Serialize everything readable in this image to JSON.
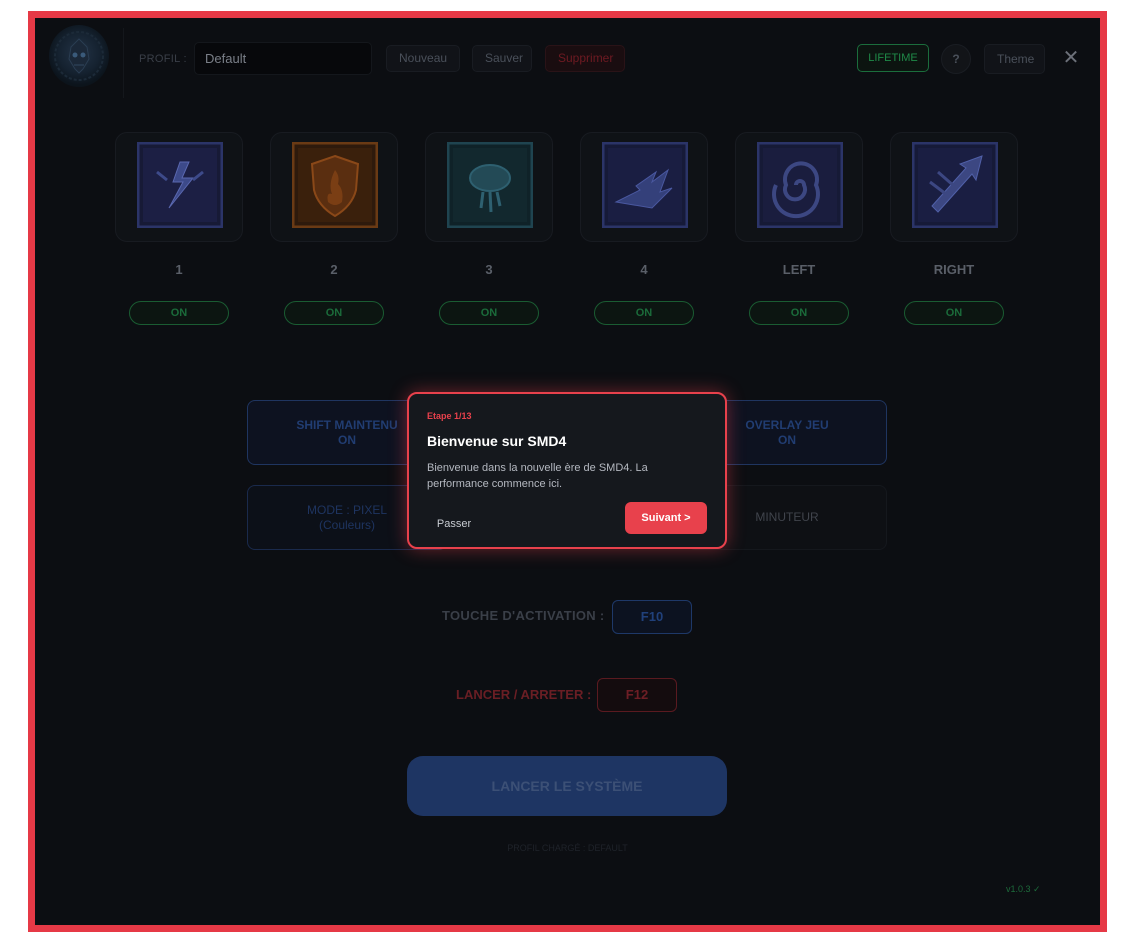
{
  "topbar": {
    "profile_label": "PROFIL :",
    "profile_value": "Default",
    "new_label": "Nouveau",
    "save_label": "Sauver",
    "delete_label": "Supprimer",
    "lifetime_label": "LIFETIME",
    "help_label": "?",
    "theme_label": "Theme",
    "close_label": "✕"
  },
  "skills": [
    {
      "label": "1",
      "toggle": "ON"
    },
    {
      "label": "2",
      "toggle": "ON"
    },
    {
      "label": "3",
      "toggle": "ON"
    },
    {
      "label": "4",
      "toggle": "ON"
    },
    {
      "label": "LEFT",
      "toggle": "ON"
    },
    {
      "label": "RIGHT",
      "toggle": "ON"
    }
  ],
  "options": {
    "shift": {
      "line1": "SHIFT MAINTENU",
      "line2": "ON"
    },
    "overlay": {
      "line1": "OVERLAY JEU",
      "line2": "ON"
    },
    "mode": {
      "line1": "MODE : PIXEL",
      "line2": "(Couleurs)"
    },
    "timer": {
      "line1": "MINUTEUR"
    }
  },
  "hotkeys": {
    "activation_label": "TOUCHE D'ACTIVATION :",
    "activation_key": "F10",
    "run_label": "LANCER / ARRETER :",
    "run_key": "F12"
  },
  "launch_label": "LANCER LE SYSTÈME",
  "profile_status": "PROFIL CHARGÉ : DEFAULT",
  "version": "v1.0.3 ✓",
  "tour": {
    "step": "Etape 1/13",
    "title": "Bienvenue sur SMD4",
    "body": "Bienvenue dans la nouvelle ère de SMD4. La performance commence ici.",
    "skip_label": "Passer",
    "next_label": "Suivant >"
  },
  "colors": {
    "accent_red": "#e8414c",
    "on_green": "#1b6b3a",
    "primary_blue": "#1e3563"
  },
  "icons": [
    "app-logo-icon",
    "skill-lightning-icon",
    "skill-fire-shield-icon",
    "skill-ice-cloud-icon",
    "skill-storm-wave-icon",
    "skill-vortex-icon",
    "skill-spear-icon",
    "close-icon"
  ]
}
